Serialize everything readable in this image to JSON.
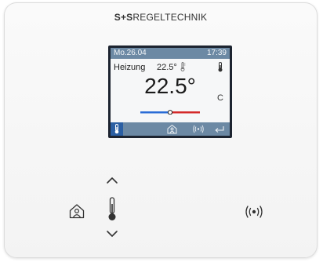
{
  "brand": {
    "part1": "S+S",
    "part2": "REGELTECHNIK"
  },
  "display": {
    "date": "Mo.26.04",
    "time": "17:39",
    "mode": "Heizung",
    "setpoint": "22.5°",
    "temperature": "22.5°",
    "unit": "C"
  },
  "icons": {
    "up": "chevron-up-icon",
    "down": "chevron-down-icon",
    "home": "home-person-icon",
    "thermometer": "thermometer-icon",
    "wireless": "wireless-icon",
    "return": "return-arrow-icon"
  },
  "colors": {
    "screen_bar": "#6c89a4",
    "selected_tab": "#2b5fa3",
    "cold": "#2a6cd6",
    "warm": "#d42a2a"
  }
}
